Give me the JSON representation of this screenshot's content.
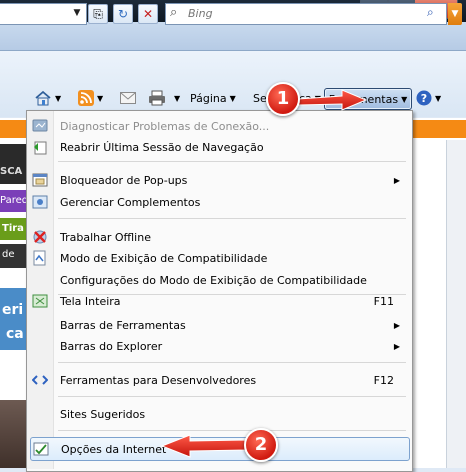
{
  "window": {
    "minimize": "▁",
    "maximize": "❐",
    "close": "✕"
  },
  "addressbar": {
    "dropdown": "▼",
    "compat_icon": "⎘",
    "refresh_icon": "↻",
    "stop_icon": "✕"
  },
  "search": {
    "placeholder": "Bing",
    "go": "🔍",
    "dropdown": "▼"
  },
  "command_bar": {
    "page_label": "Página",
    "security_label": "Segurança",
    "tools_label": "Ferramentas",
    "arrow": "▼"
  },
  "annotations": {
    "step1": "1",
    "step2": "2"
  },
  "menu": {
    "items": [
      {
        "label": "Diagnosticar Problemas de Conexão...",
        "disabled": true,
        "icon": "diagnose-icon"
      },
      {
        "label": "Reabrir Última Sessão de Navegação",
        "icon": "reopen-session-icon"
      },
      {
        "label": "Bloqueador de Pop-ups",
        "submenu": true,
        "icon": "popup-blocker-icon"
      },
      {
        "label": "Gerenciar Complementos",
        "icon": "addons-icon"
      },
      {
        "label": "Trabalhar Offline",
        "icon": "offline-icon"
      },
      {
        "label": "Modo de Exibição de Compatibilidade",
        "icon": "compat-view-icon"
      },
      {
        "label": "Configurações do Modo de Exibição de Compatibilidade",
        "icon": ""
      },
      {
        "label": "Tela Inteira",
        "shortcut": "F11",
        "icon": "fullscreen-icon"
      },
      {
        "label": "Barras de Ferramentas",
        "submenu": true,
        "icon": ""
      },
      {
        "label": "Barras do Explorer",
        "submenu": true,
        "icon": ""
      },
      {
        "label": "Ferramentas para Desenvolvedores",
        "shortcut": "F12",
        "icon": "devtools-icon"
      },
      {
        "label": "Sites Sugeridos",
        "icon": ""
      },
      {
        "label": "Opções da Internet",
        "icon": "internet-options-icon",
        "highlighted": true
      }
    ],
    "submenu_arrow": "▶"
  },
  "page_behind": {
    "fragments": [
      "SCA",
      "Pared",
      "Tira",
      "de",
      "eri",
      "ca"
    ]
  },
  "colors": {
    "accent_red": "#d01a10",
    "orange": "#f58a14",
    "highlight_border": "#7da2ce"
  }
}
